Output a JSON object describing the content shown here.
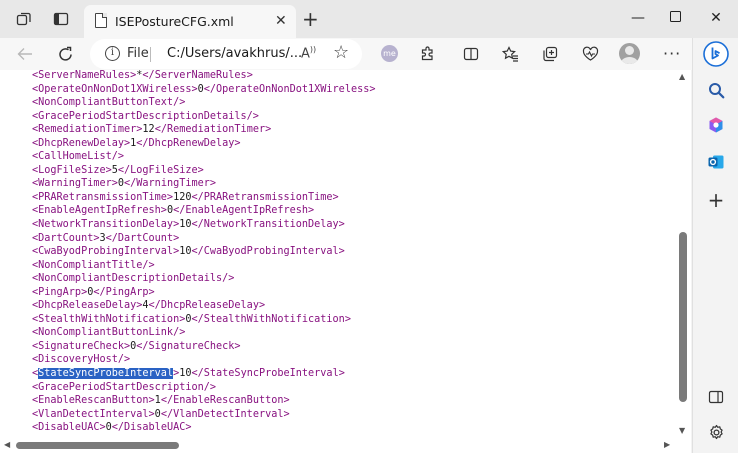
{
  "tab": {
    "title": "ISEPostureCFG.xml"
  },
  "address": {
    "label": "File",
    "url": "C:/Users/avakhrus/...",
    "read_aloud": "A͡"
  },
  "profile": {
    "initials": "me"
  },
  "icons": {
    "workspaces": "workspaces-icon",
    "tab_actions": "vertical-tabs-icon",
    "new_tab": "plus-icon",
    "back": "back-arrow-icon",
    "refresh": "refresh-icon",
    "info": "info-icon",
    "favorite": "star-icon",
    "extensions": "puzzle-icon",
    "split": "split-screen-icon",
    "favorites": "favorites-icon",
    "collections": "collections-icon",
    "health": "browser-essentials-icon",
    "copilot": "bing-copilot-icon",
    "search": "search-icon",
    "office": "office-icon",
    "outlook": "outlook-icon",
    "add": "add-icon",
    "sidebar_toggle": "sidebar-panel-icon",
    "settings": "gear-icon"
  },
  "colors": {
    "tag": "#881280",
    "selection": "#2a62c4",
    "accent": "#1b6fd8"
  },
  "lines": [
    {
      "pre": "<ServerNameRules>",
      "val": "*",
      "post": "</ServerNameRules>"
    },
    {
      "pre": "<OperateOnNonDot1XWireless>",
      "val": "0",
      "post": "</OperateOnNonDot1XWireless>"
    },
    {
      "pre": "<NonCompliantButtonText/>",
      "val": "",
      "post": ""
    },
    {
      "pre": "<GracePeriodStartDescriptionDetails/>",
      "val": "",
      "post": ""
    },
    {
      "pre": "<RemediationTimer>",
      "val": "12",
      "post": "</RemediationTimer>"
    },
    {
      "pre": "<DhcpRenewDelay>",
      "val": "1",
      "post": "</DhcpRenewDelay>"
    },
    {
      "pre": "<CallHomeList/>",
      "val": "",
      "post": ""
    },
    {
      "pre": "<LogFileSize>",
      "val": "5",
      "post": "</LogFileSize>"
    },
    {
      "pre": "<WarningTimer>",
      "val": "0",
      "post": "</WarningTimer>"
    },
    {
      "pre": "<PRARetransmissionTime>",
      "val": "120",
      "post": "</PRARetransmissionTime>"
    },
    {
      "pre": "<EnableAgentIpRefresh>",
      "val": "0",
      "post": "</EnableAgentIpRefresh>"
    },
    {
      "pre": "<NetworkTransitionDelay>",
      "val": "10",
      "post": "</NetworkTransitionDelay>"
    },
    {
      "pre": "<DartCount>",
      "val": "3",
      "post": "</DartCount>"
    },
    {
      "pre": "<CwaByodProbingInterval>",
      "val": "10",
      "post": "</CwaByodProbingInterval>"
    },
    {
      "pre": "<NonCompliantTitle/>",
      "val": "",
      "post": ""
    },
    {
      "pre": "<NonCompliantDescriptionDetails/>",
      "val": "",
      "post": ""
    },
    {
      "pre": "<PingArp>",
      "val": "0",
      "post": "</PingArp>"
    },
    {
      "pre": "<DhcpReleaseDelay>",
      "val": "4",
      "post": "</DhcpReleaseDelay>"
    },
    {
      "pre": "<StealthWithNotification>",
      "val": "0",
      "post": "</StealthWithNotification>"
    },
    {
      "pre": "<NonCompliantButtonLink/>",
      "val": "",
      "post": ""
    },
    {
      "pre": "<SignatureCheck>",
      "val": "0",
      "post": "</SignatureCheck>"
    },
    {
      "pre": "<DiscoveryHost/>",
      "val": "",
      "post": ""
    },
    {
      "pre": "<StateSyncProbeInterval>",
      "val": "10",
      "post": "</StateSyncProbeInterval>",
      "selected": "StateSyncProbeInterval"
    },
    {
      "pre": "<GracePeriodStartDescription/>",
      "val": "",
      "post": ""
    },
    {
      "pre": "<EnableRescanButton>",
      "val": "1",
      "post": "</EnableRescanButton>"
    },
    {
      "pre": "<VlanDetectInterval>",
      "val": "0",
      "post": "</VlanDetectInterval>"
    },
    {
      "pre": "<DisableUAC>",
      "val": "0",
      "post": "</DisableUAC>"
    }
  ]
}
